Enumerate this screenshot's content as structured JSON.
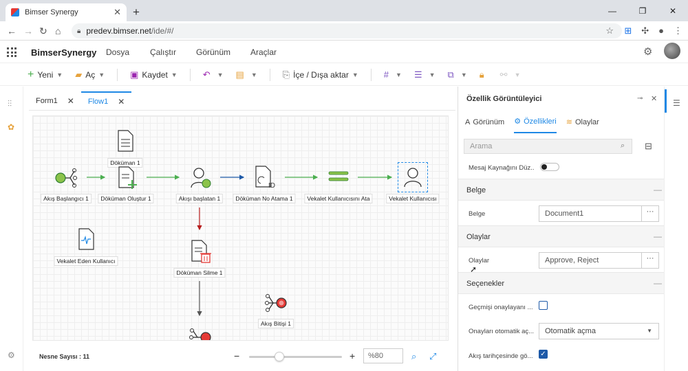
{
  "browser": {
    "tab_title": "Bimser Synergy",
    "new_tab": "+",
    "url_host": "predev.bimser.net",
    "url_path": "/ide/#/"
  },
  "app": {
    "brand": "BimserSynergy",
    "menu": [
      "Dosya",
      "Çalıştır",
      "Görünüm",
      "Araçlar"
    ]
  },
  "toolbar": {
    "new_label": "Yeni",
    "open_label": "Aç",
    "save_label": "Kaydet",
    "import_export_label": "İçe / Dışa aktar"
  },
  "doc_tabs": [
    {
      "label": "Form1",
      "active": false
    },
    {
      "label": "Flow1",
      "active": true
    }
  ],
  "flow_nodes": {
    "start": "Akış Başlangıcı 1",
    "doc": "Döküman 1",
    "create_doc": "Döküman Oluştur 1",
    "flow_starter": "Akışı başlatan 1",
    "doc_number": "Döküman No Atama 1",
    "set_delegate": "Vekalet Kullanıcısını Ata",
    "delegate_user": "Vekalet Kullanıcısı",
    "delegating_user": "Vekalet Eden Kullanıcı",
    "delete_doc": "Döküman Silme 1",
    "flow_end": "Akış Bitişi 1"
  },
  "status": {
    "object_count": "Nesne Sayısı : 11",
    "zoom": "%80"
  },
  "panel": {
    "title": "Özellik Görüntüleyici",
    "tabs": [
      "Görünüm",
      "Özellikleri",
      "Olaylar"
    ],
    "active_tab": "Özellikleri",
    "search_placeholder": "Arama",
    "message_source_label": "Mesaj Kaynağını Düz...",
    "section_belge": "Belge",
    "belge_label": "Belge",
    "belge_value": "Document1",
    "section_olaylar": "Olaylar",
    "olaylar_label": "Olaylar",
    "olaylar_value": "Approve, Reject",
    "section_secenekler": "Seçenekler",
    "history_approver_label": "Geçmişi onaylayanı ...",
    "auto_open_label": "Onayları otomatik aç...",
    "auto_open_value": "Otomatik açma",
    "flow_history_label": "Akış tarihçesinde gö...",
    "dots": "···"
  },
  "colors": {
    "accent": "#1e88e5",
    "flow_green": "#4caf50",
    "flow_red": "#e53935"
  }
}
